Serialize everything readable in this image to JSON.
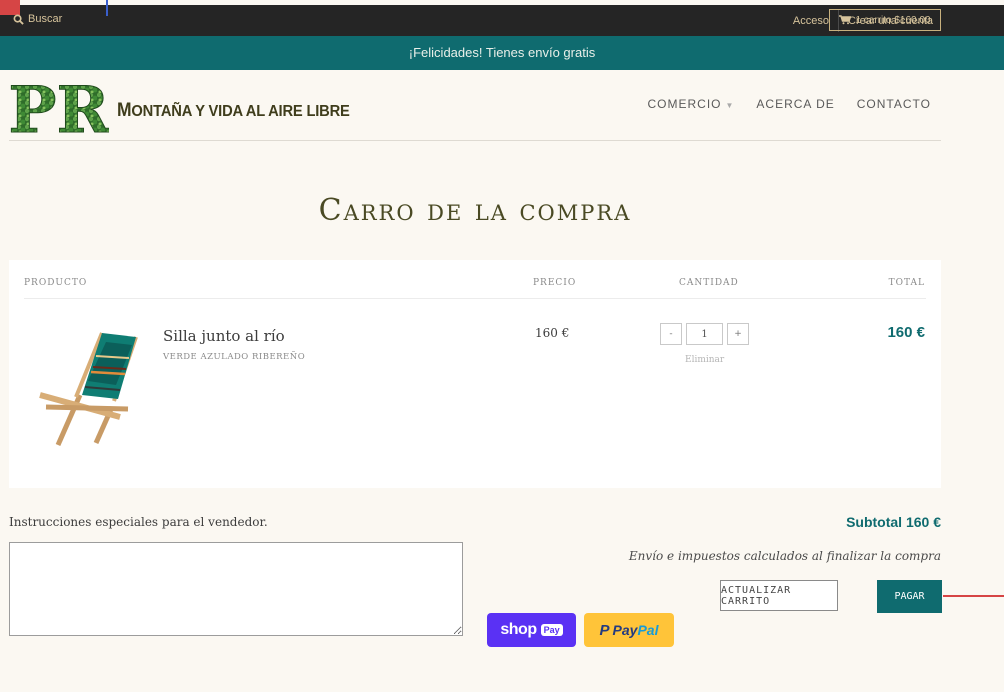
{
  "topbar": {
    "search_label": "Buscar",
    "login_label": "Acceso",
    "create_account_label": "Crear una cuenta",
    "cart_label": "1 carrito $160.00"
  },
  "promo": {
    "text": "¡Felicidades! Tienes envío gratis"
  },
  "header": {
    "logo_text": "PR",
    "brand_first": "M",
    "brand_rest": "ONTAÑA Y VIDA AL AIRE LIBRE",
    "nav": [
      {
        "label": "COMERCIO"
      },
      {
        "label": "ACERCA DE"
      },
      {
        "label": "CONTACTO"
      }
    ]
  },
  "page": {
    "title": "Carro de la compra"
  },
  "table": {
    "headers": {
      "product": "PRODUCTO",
      "price": "PRECIO",
      "quantity": "CANTIDAD",
      "total": "TOTAL"
    },
    "items": [
      {
        "name": "Silla junto al río",
        "variant": "VERDE AZULADO RIBEREÑO",
        "price": "160 €",
        "quantity": "1",
        "decrement": "-",
        "increment": "+",
        "remove": "Eliminar",
        "total": "160 €"
      }
    ]
  },
  "footer": {
    "instructions_label": "Instrucciones especiales para el vendedor.",
    "subtotal": "Subtotal 160 €",
    "shipping_note": "Envío e impuestos calculados al finalizar la compra",
    "update_label": "ACTUALIZAR CARRITO",
    "checkout_label": "PAGAR",
    "shoppay_text": "shop",
    "shoppay_badge": "Pay",
    "paypal_p": "P",
    "paypal_pay": "Pay",
    "paypal_pal": "Pal"
  },
  "colors": {
    "accent": "#0f6b6f",
    "topbar": "#252525",
    "background": "#fbf8f2",
    "brand": "#3f3d1c",
    "shoppay": "#5a31f4",
    "paypal": "#ffc439"
  },
  "icons": [
    "search-icon",
    "cart-icon",
    "caret-down-icon",
    "shoppay-logo",
    "paypal-logo"
  ]
}
